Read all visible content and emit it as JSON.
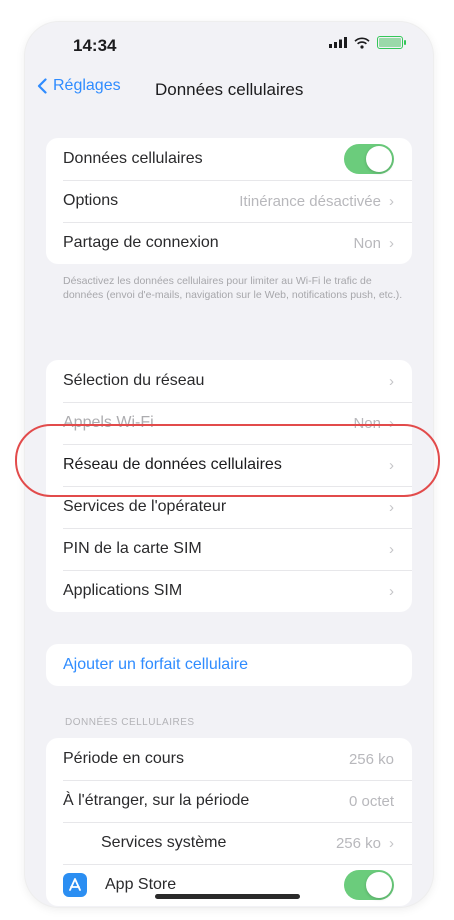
{
  "status_bar": {
    "time": "14:34"
  },
  "nav": {
    "back_label": "Réglages",
    "title": "Données cellulaires"
  },
  "group1": {
    "cellular_data": {
      "label": "Données cellulaires",
      "toggle_on": true
    },
    "options": {
      "label": "Options",
      "value": "Itinérance désactivée"
    },
    "hotspot": {
      "label": "Partage de connexion",
      "value": "Non"
    }
  },
  "footnote": "Désactivez les données cellulaires pour limiter au Wi-Fi le trafic de données (envoi d'e-mails, navigation sur le Web, notifications push, etc.).",
  "group2": {
    "network_selection": {
      "label": "Sélection du réseau"
    },
    "wifi_calls": {
      "label": "Appels Wi-Fi",
      "value": "Non"
    },
    "cellular_network": {
      "label": "Réseau de données cellulaires"
    },
    "carrier_services": {
      "label": "Services de l'opérateur"
    },
    "sim_pin": {
      "label": "PIN de la carte SIM"
    },
    "sim_apps": {
      "label": "Applications SIM"
    }
  },
  "add_plan": {
    "label": "Ajouter un forfait cellulaire"
  },
  "usage": {
    "header": "DONNÉES CELLULAIRES",
    "current_period": {
      "label": "Période en cours",
      "value": "256 ko"
    },
    "roaming_period": {
      "label": "À l'étranger, sur la période",
      "value": "0 octet"
    },
    "system_services": {
      "label": "Services système",
      "value": "256 ko"
    },
    "app_store": {
      "label": "App Store",
      "toggle_on": true
    }
  },
  "colors": {
    "accent": "#2f8cff",
    "toggle_on": "#6bcc7c",
    "highlight": "#e24b4b"
  }
}
